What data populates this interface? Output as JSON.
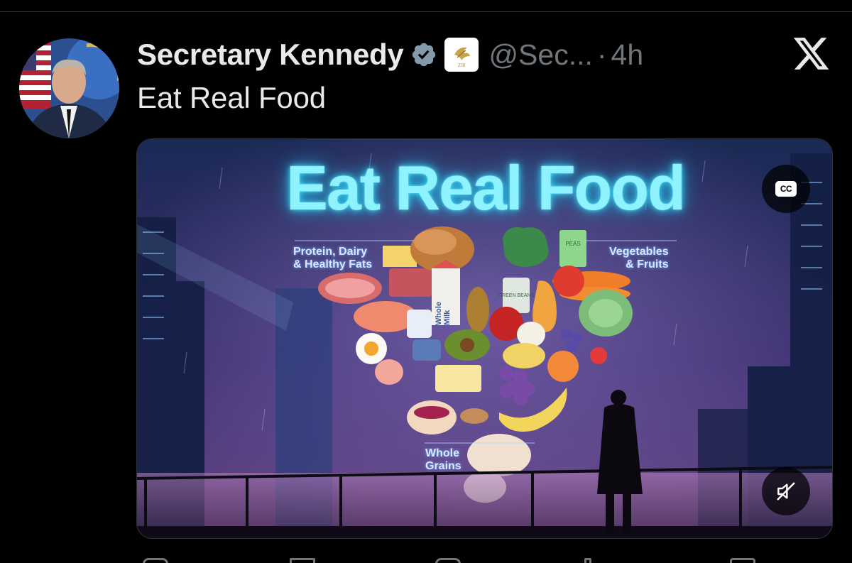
{
  "post": {
    "display_name": "Secretary Kennedy",
    "handle": "@Sec...",
    "separator": "·",
    "time": "4h",
    "text": "Eat Real Food",
    "affiliate_badge_text": "250"
  },
  "media": {
    "title": "Eat Real Food",
    "labels": {
      "protein_line1": "Protein, Dairy",
      "protein_line2": "& Healthy Fats",
      "veg_line1": "Vegetables",
      "veg_line2": "& Fruits",
      "grains_line1": "Whole",
      "grains_line2": "Grains"
    },
    "packaging": {
      "milk_line1": "Whole",
      "milk_line2": "Milk",
      "can": "GREEN BEANS",
      "peas": "PEAS"
    },
    "cc_label": "CC"
  },
  "icons": {
    "verified": "verified-badge-icon",
    "platform": "x-logo-icon",
    "captions": "closed-captions-icon",
    "sound": "muted-speaker-icon"
  },
  "colors": {
    "background": "#000000",
    "text_primary": "#e7e9ea",
    "text_secondary": "#71767b",
    "verified_badge": "#829aab",
    "neon_title": "#8ff3ff"
  }
}
